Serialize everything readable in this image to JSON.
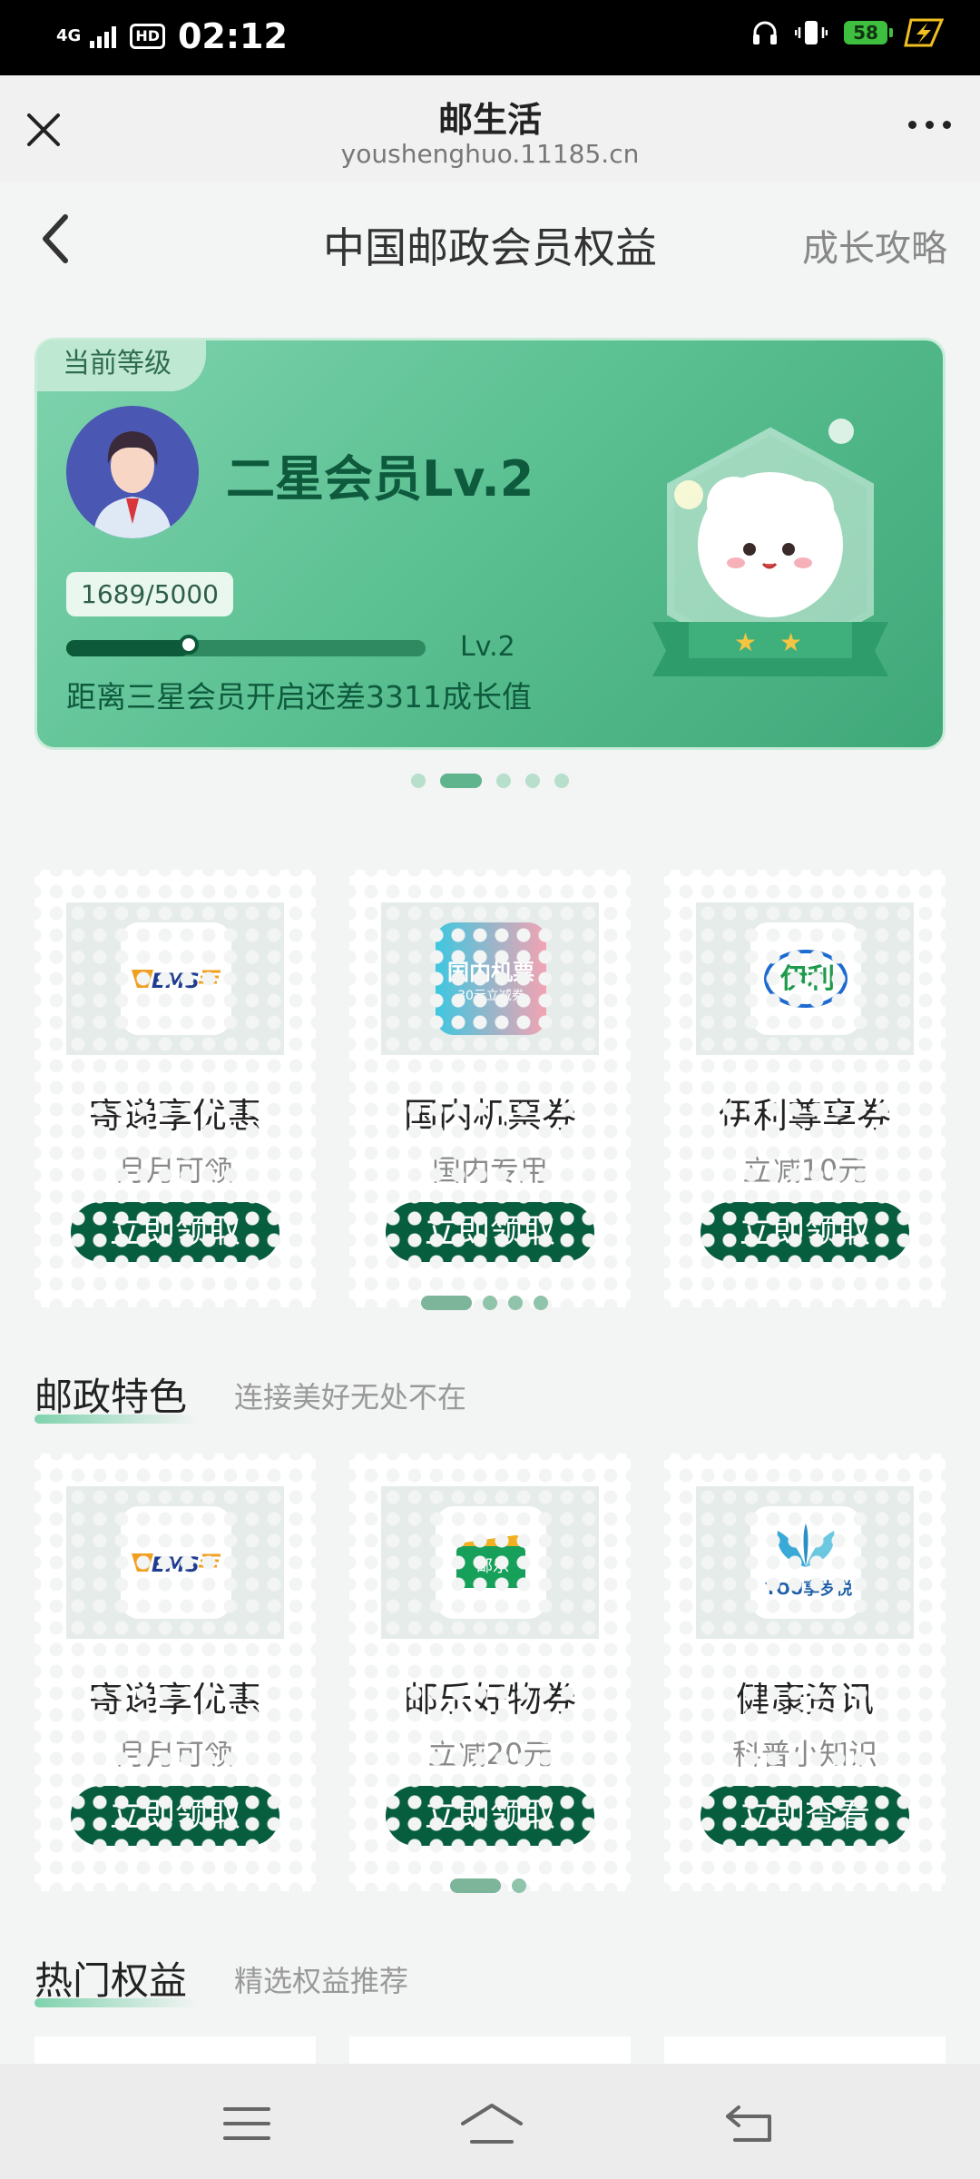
{
  "status_bar": {
    "network": "4G",
    "hd": "HD",
    "time": "02:12",
    "battery": "58"
  },
  "browser": {
    "title": "邮生活",
    "url": "youshenghuo.11185.cn"
  },
  "header": {
    "title": "中国邮政会员权益",
    "right_link": "成长攻略"
  },
  "member_card": {
    "tag": "当前等级",
    "level_name": "二星会员Lv.2",
    "growth": "1689/5000",
    "progress": 0.34,
    "next_level": "Lv.2",
    "gap_text": "距离三星会员开启还差3311成长值"
  },
  "benefits_row1": [
    {
      "title": "寄递享优惠",
      "sub": "月月可领",
      "button": "立即领取",
      "logo": "ems-logo"
    },
    {
      "title": "国内机票券",
      "sub": "国内专用",
      "button": "立即领取",
      "logo": "flight-ticket-logo",
      "logo_text_1": "国内机票",
      "logo_text_2": "30元立减券"
    },
    {
      "title": "伊利尊享券",
      "sub": "立减10元",
      "button": "立即领取",
      "logo": "yili-logo",
      "logo_text": "伊利"
    }
  ],
  "section_postal": {
    "title": "邮政特色",
    "subtitle": "连接美好无处不在"
  },
  "benefits_row2": [
    {
      "title": "寄递享优惠",
      "sub": "月月可领",
      "button": "立即领取",
      "logo": "ems-logo"
    },
    {
      "title": "邮乐好物券",
      "sub": "立减20元",
      "button": "立即领取",
      "logo": "youle-logo",
      "logo_text": "邮乐"
    },
    {
      "title": "健康资讯",
      "sub": "科普小知识",
      "button": "立即查看",
      "logo": "you-xiangsuiyue-logo",
      "logo_text": "YOU享岁悦"
    }
  ],
  "section_hot": {
    "title": "热门权益",
    "subtitle": "精选权益推荐"
  },
  "logo_text": {
    "ems": "EMS"
  },
  "colors": {
    "accent": "#075e3e",
    "card": "#5cc193"
  }
}
